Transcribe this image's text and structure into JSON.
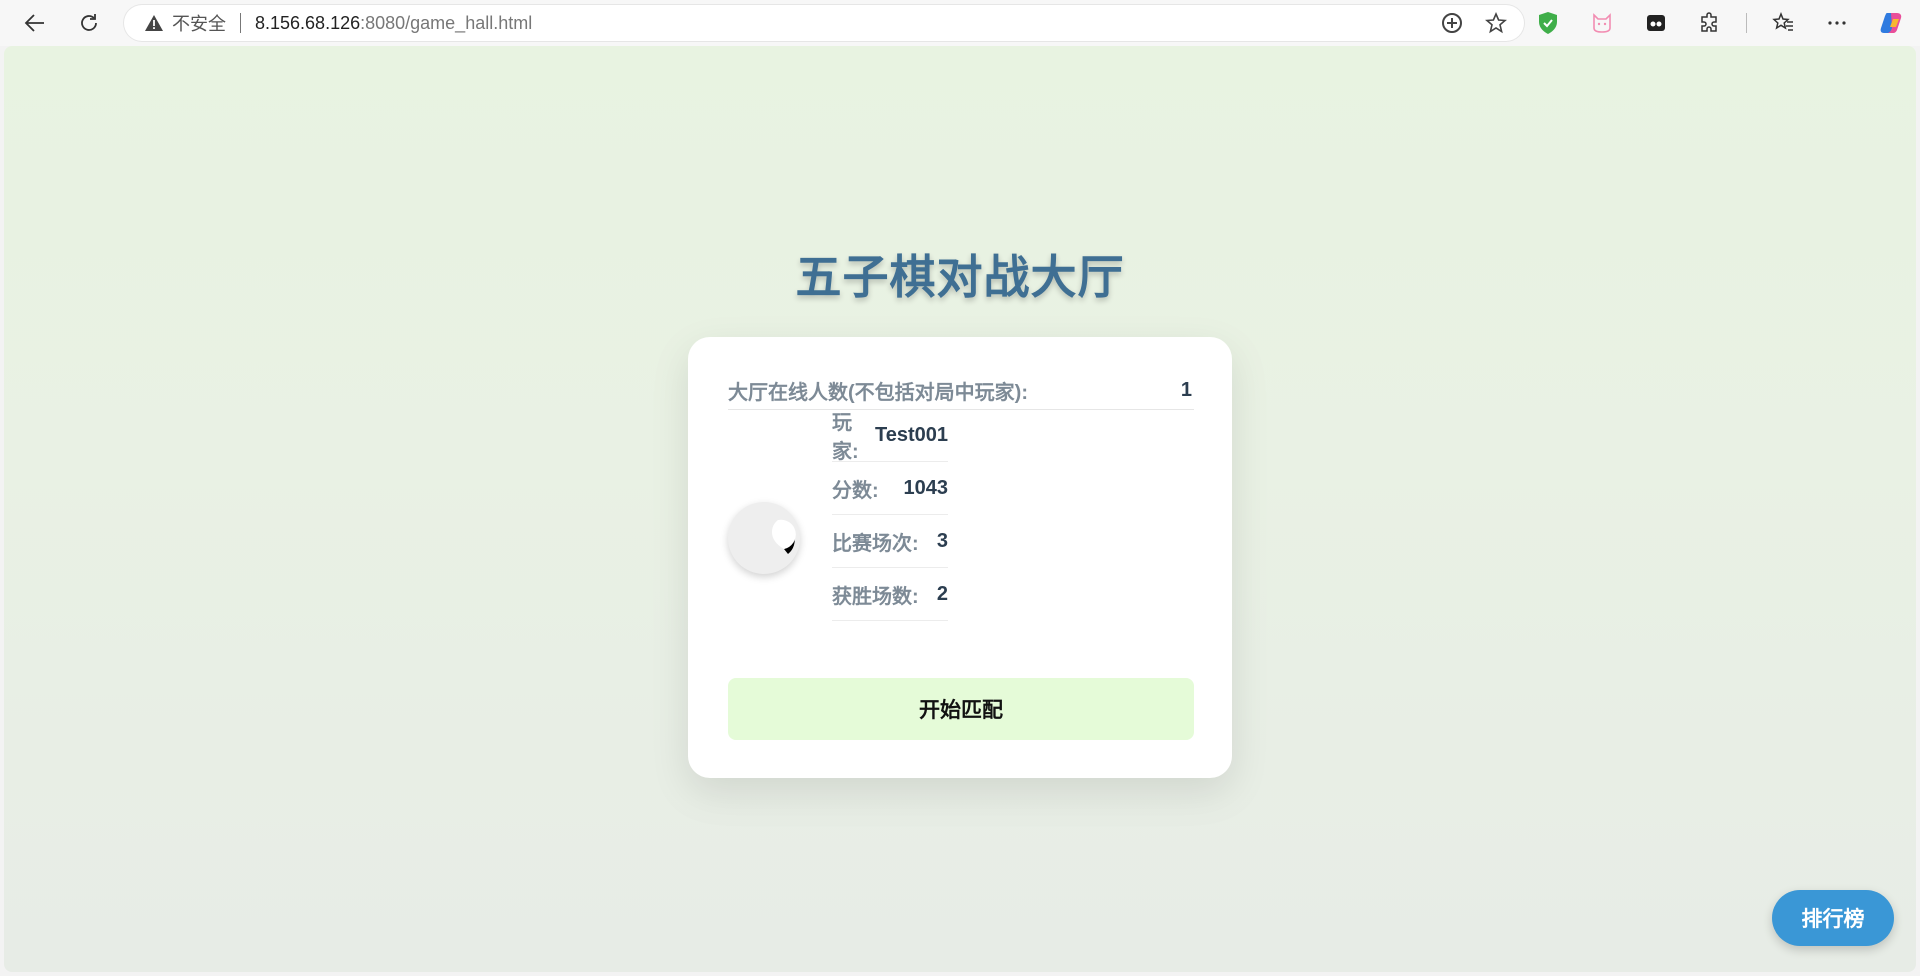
{
  "browser": {
    "security_label": "不安全",
    "url_host": "8.156.68.126",
    "url_rest": ":8080/game_hall.html",
    "icons": [
      "back-arrow-icon",
      "reload-icon",
      "warning-icon",
      "immersive-reader-icon",
      "favorite-star-icon",
      "shield-extension-icon",
      "cat-extension-icon",
      "game-extension-icon",
      "extensions-puzzle-icon",
      "favorites-icon",
      "more-options-icon",
      "copilot-icon"
    ]
  },
  "hall": {
    "title": "五子棋对战大厅",
    "online_label": "大厅在线人数(不包括对局中玩家):",
    "online_count": "1",
    "player": {
      "name_label": "玩家:",
      "name": "Test001",
      "score_label": "分数:",
      "score": "1043",
      "matches_label": "比赛场次:",
      "matches": "3",
      "wins_label": "获胜场数:",
      "wins": "2"
    },
    "match_button": "开始匹配",
    "leaderboard_button": "排行榜"
  },
  "colors": {
    "title": "#3f6f93",
    "match_button_bg": "#e5fbd8",
    "leaderboard_bg": "#3a97d6"
  }
}
